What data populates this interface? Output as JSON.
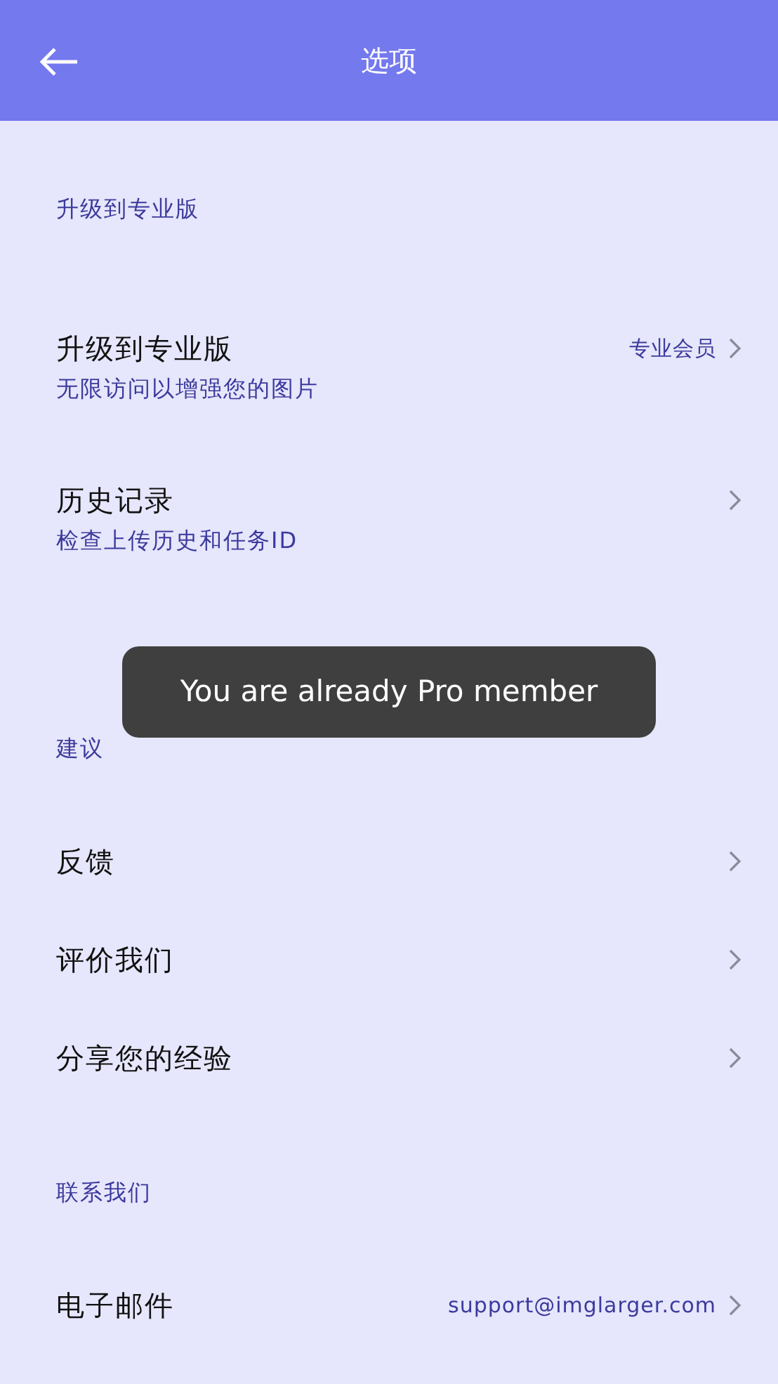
{
  "header": {
    "title": "选项"
  },
  "sections": [
    {
      "title": "升级到专业版",
      "items": [
        {
          "title": "升级到专业版",
          "subtitle": "无限访问以增强您的图片",
          "value": "专业会员"
        },
        {
          "title": "历史记录",
          "subtitle": "检查上传历史和任务ID"
        }
      ]
    },
    {
      "title": "建议",
      "items": [
        {
          "title": "反馈"
        },
        {
          "title": "评价我们"
        },
        {
          "title": "分享您的经验"
        }
      ]
    },
    {
      "title": "联系我们",
      "items": [
        {
          "title": "电子邮件",
          "value": "support@imglarger.com"
        }
      ]
    }
  ],
  "toast": {
    "text": "You are already Pro member"
  }
}
